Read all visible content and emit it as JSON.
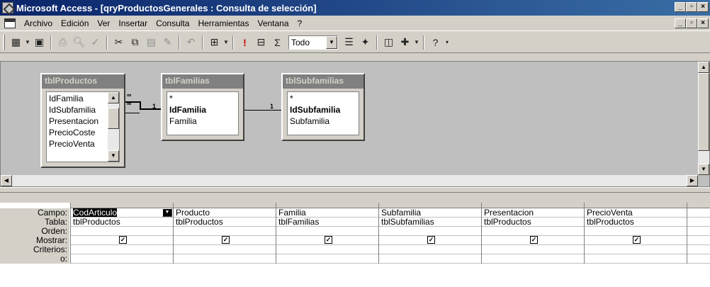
{
  "window": {
    "title": "Microsoft Access - [qryProductosGenerales : Consulta de selección]",
    "min": "_",
    "max": "▫",
    "close": "×"
  },
  "menu": [
    "Archivo",
    "Edición",
    "Ver",
    "Insertar",
    "Consulta",
    "Herramientas",
    "Ventana",
    "?"
  ],
  "toolbar": {
    "combo_value": "Todo",
    "icons": [
      "view-icon",
      "save-icon",
      "print-icon",
      "preview-icon",
      "spelling-icon",
      "cut-icon",
      "copy-icon",
      "paste-icon",
      "format-painter-icon",
      "undo-icon",
      "query-type-icon",
      "run-icon",
      "show-table-icon",
      "totals-icon",
      "properties-icon",
      "builder-icon",
      "database-window-icon",
      "new-object-icon",
      "help-icon"
    ]
  },
  "tables": [
    {
      "name": "tblProductos",
      "fields": [
        "IdFamilia",
        "IdSubfamilia",
        "Presentacion",
        "PrecioCoste",
        "PrecioVenta"
      ]
    },
    {
      "name": "tblFamilias",
      "fields": [
        "*",
        "IdFamilia",
        "Familia"
      ],
      "key": "IdFamilia"
    },
    {
      "name": "tblSubfamilias",
      "fields": [
        "*",
        "IdSubfamilia",
        "Subfamilia"
      ],
      "key": "IdSubfamilia"
    }
  ],
  "relations": {
    "many": "∞",
    "one": "1"
  },
  "grid": {
    "row_labels": [
      "Campo:",
      "Tabla:",
      "Orden:",
      "Mostrar:",
      "Criterios:",
      "o:"
    ],
    "columns": [
      {
        "campo": "CodArticulo",
        "tabla": "tblProductos",
        "mostrar": true
      },
      {
        "campo": "Producto",
        "tabla": "tblProductos",
        "mostrar": true
      },
      {
        "campo": "Familia",
        "tabla": "tblFamilias",
        "mostrar": true
      },
      {
        "campo": "Subfamilia",
        "tabla": "tblSubfamilias",
        "mostrar": true
      },
      {
        "campo": "Presentacion",
        "tabla": "tblProductos",
        "mostrar": true
      },
      {
        "campo": "PrecioVenta",
        "tabla": "tblProductos",
        "mostrar": true
      }
    ]
  }
}
